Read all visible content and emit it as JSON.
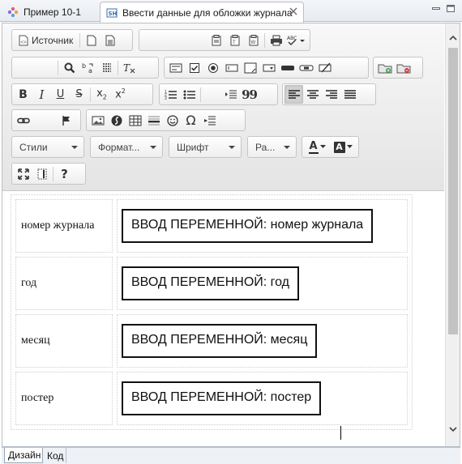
{
  "editor_tabs": [
    {
      "label": "Пример 10-1",
      "icon": "gear-flower-icon"
    },
    {
      "label": "Ввести данные для обложки журнала",
      "icon": "form-dialog-icon"
    }
  ],
  "toolbar": {
    "source_label": "Источник",
    "combos": {
      "styles": "Стили",
      "format": "Формат...",
      "font": "Шрифт",
      "size": "Ра..."
    },
    "letters": {
      "bold": "B",
      "italic": "I",
      "underline": "U",
      "strike": "S",
      "subscript": "x",
      "subscript_sub": "2",
      "superscript": "x",
      "superscript_sup": "2",
      "font_color": "A",
      "bg_color": "A",
      "help": "?",
      "omega": "Ω",
      "quote": "99"
    }
  },
  "content": {
    "rows": [
      {
        "label": "номер журнала",
        "value": "ВВОД ПЕРЕМЕННОЙ: номер журнала"
      },
      {
        "label": "год",
        "value": "ВВОД ПЕРЕМЕННОЙ: год"
      },
      {
        "label": "месяц",
        "value": "ВВОД ПЕРЕМЕННОЙ: месяц"
      },
      {
        "label": "постер",
        "value": "ВВОД ПЕРЕМЕННОЙ: постер"
      }
    ]
  },
  "bottom_tabs": [
    {
      "label": "Дизайн"
    },
    {
      "label": "Код"
    }
  ],
  "colors": {
    "toolbar_bg": "#e8e8e8",
    "tab_border": "#b7bfc9",
    "var_border": "#111111",
    "active_button": "#d0d0d0"
  }
}
